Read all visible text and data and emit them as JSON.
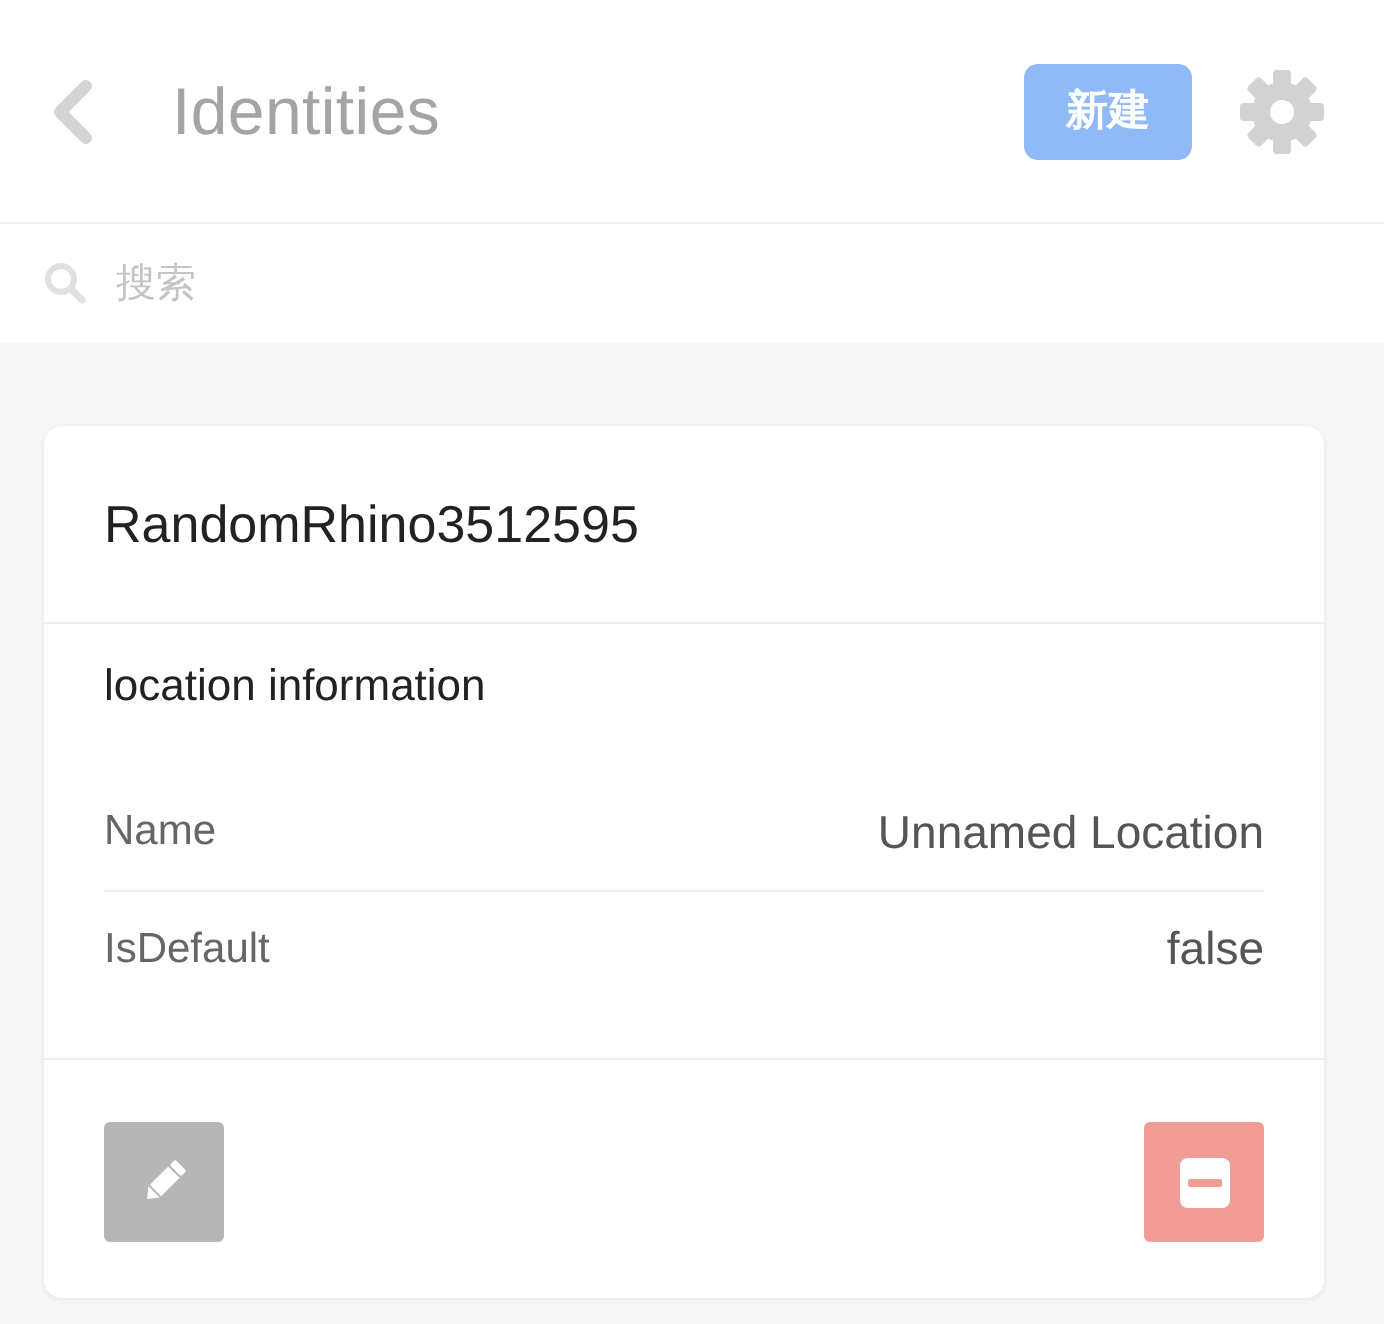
{
  "header": {
    "title": "Identities",
    "new_button": "新建"
  },
  "search": {
    "placeholder": "搜索"
  },
  "identities": [
    {
      "name": "RandomRhino3512595",
      "section_title": "location information",
      "fields": [
        {
          "label": "Name",
          "value": "Unnamed Location"
        },
        {
          "label": "IsDefault",
          "value": "false"
        }
      ]
    }
  ]
}
